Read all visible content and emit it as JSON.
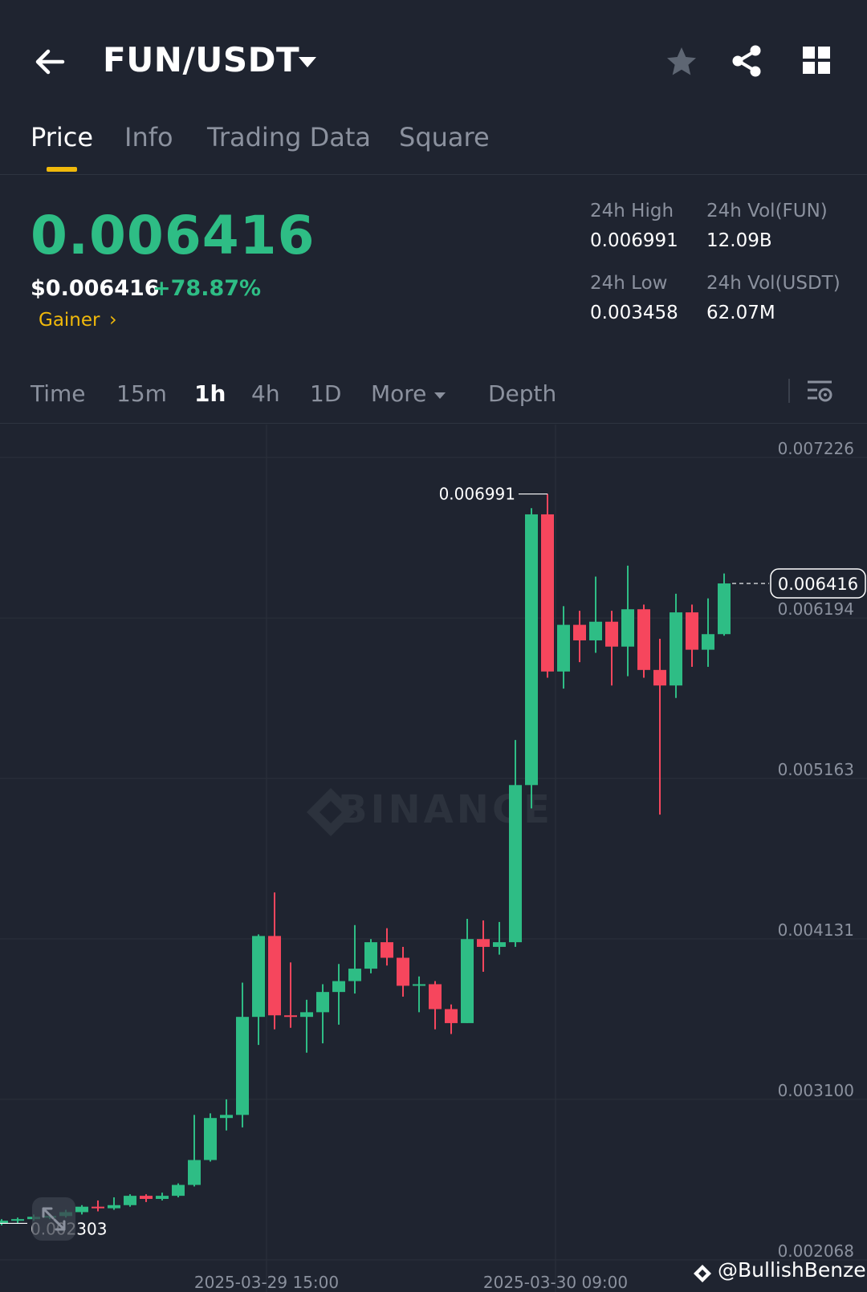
{
  "header": {
    "pair": "FUN/USDT",
    "icons": [
      "back-arrow-icon",
      "caret-down-icon",
      "star-icon",
      "share-icon",
      "grid-icon"
    ]
  },
  "tabs": [
    {
      "label": "Price",
      "active": true
    },
    {
      "label": "Info",
      "active": false
    },
    {
      "label": "Trading Data",
      "active": false
    },
    {
      "label": "Square",
      "active": false
    }
  ],
  "price": {
    "last": "0.006416",
    "usd": "$0.006416",
    "change": "+78.87%",
    "tag": "Gainer",
    "tag_chevron": "›"
  },
  "stats": {
    "high_label": "24h High",
    "high_value": "0.006991",
    "low_label": "24h Low",
    "low_value": "0.003458",
    "vol_base_label": "24h Vol(FUN)",
    "vol_base_value": "12.09B",
    "vol_quote_label": "24h Vol(USDT)",
    "vol_quote_value": "62.07M"
  },
  "intervals": [
    {
      "label": "Time",
      "active": false
    },
    {
      "label": "15m",
      "active": false
    },
    {
      "label": "1h",
      "active": true
    },
    {
      "label": "4h",
      "active": false
    },
    {
      "label": "1D",
      "active": false
    },
    {
      "label": "More",
      "active": false
    },
    {
      "label": "Depth",
      "active": false
    }
  ],
  "colors": {
    "up": "#2ebd85",
    "down": "#f6465d",
    "accent": "#f0b90b",
    "background": "#1f2430"
  },
  "chart_data": {
    "type": "candlestick",
    "interval": "1h",
    "y_ticks": [
      "0.007226",
      "0.006194",
      "0.005163",
      "0.004131",
      "0.003100",
      "0.002068"
    ],
    "ylim": [
      0.002068,
      0.007226
    ],
    "x_ticks": [
      "2025-03-29 15:00",
      "2025-03-30 09:00"
    ],
    "high_marker": "0.006991",
    "low_marker": "0.002303",
    "current_price": "0.006416",
    "watermark": "BINANCE",
    "candles": [
      [
        0.002303,
        0.00232,
        0.00229,
        0.00233
      ],
      [
        0.00232,
        0.00233,
        0.002305,
        0.00234
      ],
      [
        0.00233,
        0.002345,
        0.00232,
        0.00236
      ],
      [
        0.002345,
        0.00235,
        0.00233,
        0.002365
      ],
      [
        0.00235,
        0.002375,
        0.00234,
        0.00239
      ],
      [
        0.002375,
        0.00241,
        0.00236,
        0.00242
      ],
      [
        0.00241,
        0.0024,
        0.00238,
        0.00245
      ],
      [
        0.0024,
        0.00242,
        0.00239,
        0.00247
      ],
      [
        0.00242,
        0.00248,
        0.00241,
        0.00249
      ],
      [
        0.00248,
        0.00246,
        0.00244,
        0.00249
      ],
      [
        0.00246,
        0.00248,
        0.00245,
        0.0025
      ],
      [
        0.00248,
        0.00255,
        0.00247,
        0.00256
      ],
      [
        0.00255,
        0.00271,
        0.00254,
        0.003
      ],
      [
        0.00271,
        0.00298,
        0.0027,
        0.00301
      ],
      [
        0.00298,
        0.003,
        0.0029,
        0.0031
      ],
      [
        0.003,
        0.00363,
        0.00292,
        0.00385
      ],
      [
        0.00363,
        0.00415,
        0.00345,
        0.00416
      ],
      [
        0.00415,
        0.00364,
        0.00355,
        0.00443
      ],
      [
        0.00364,
        0.00363,
        0.00356,
        0.00398
      ],
      [
        0.00363,
        0.00366,
        0.0034,
        0.00374
      ],
      [
        0.00366,
        0.00379,
        0.00346,
        0.00384
      ],
      [
        0.00379,
        0.00386,
        0.00358,
        0.00397
      ],
      [
        0.00386,
        0.00394,
        0.00378,
        0.00422
      ],
      [
        0.00394,
        0.00411,
        0.00391,
        0.00413
      ],
      [
        0.00411,
        0.00401,
        0.00396,
        0.0042
      ],
      [
        0.00401,
        0.00383,
        0.00376,
        0.00408
      ],
      [
        0.00383,
        0.00384,
        0.00366,
        0.00389
      ],
      [
        0.00384,
        0.00368,
        0.00355,
        0.00386
      ],
      [
        0.00368,
        0.00359,
        0.00352,
        0.00371
      ],
      [
        0.00359,
        0.00413,
        0.00359,
        0.00426
      ],
      [
        0.00413,
        0.00408,
        0.00392,
        0.00425
      ],
      [
        0.00408,
        0.00411,
        0.00403,
        0.00424
      ],
      [
        0.00411,
        0.00512,
        0.00408,
        0.00541
      ],
      [
        0.00512,
        0.00686,
        0.00497,
        0.0069
      ],
      [
        0.00686,
        0.00585,
        0.00581,
        0.006991
      ],
      [
        0.00585,
        0.00615,
        0.00574,
        0.00627
      ],
      [
        0.00615,
        0.00605,
        0.00591,
        0.00624
      ],
      [
        0.00605,
        0.00617,
        0.00597,
        0.00646
      ],
      [
        0.00617,
        0.00601,
        0.00576,
        0.00624
      ],
      [
        0.00601,
        0.00625,
        0.00582,
        0.00653
      ],
      [
        0.00625,
        0.00586,
        0.00581,
        0.00628
      ],
      [
        0.00586,
        0.00576,
        0.00493,
        0.00606
      ],
      [
        0.00576,
        0.00623,
        0.00568,
        0.00635
      ],
      [
        0.00623,
        0.00599,
        0.00588,
        0.00628
      ],
      [
        0.00599,
        0.00609,
        0.00588,
        0.00632
      ],
      [
        0.00609,
        0.006416,
        0.00608,
        0.00648
      ]
    ]
  },
  "credit": "@BullishBenzer"
}
